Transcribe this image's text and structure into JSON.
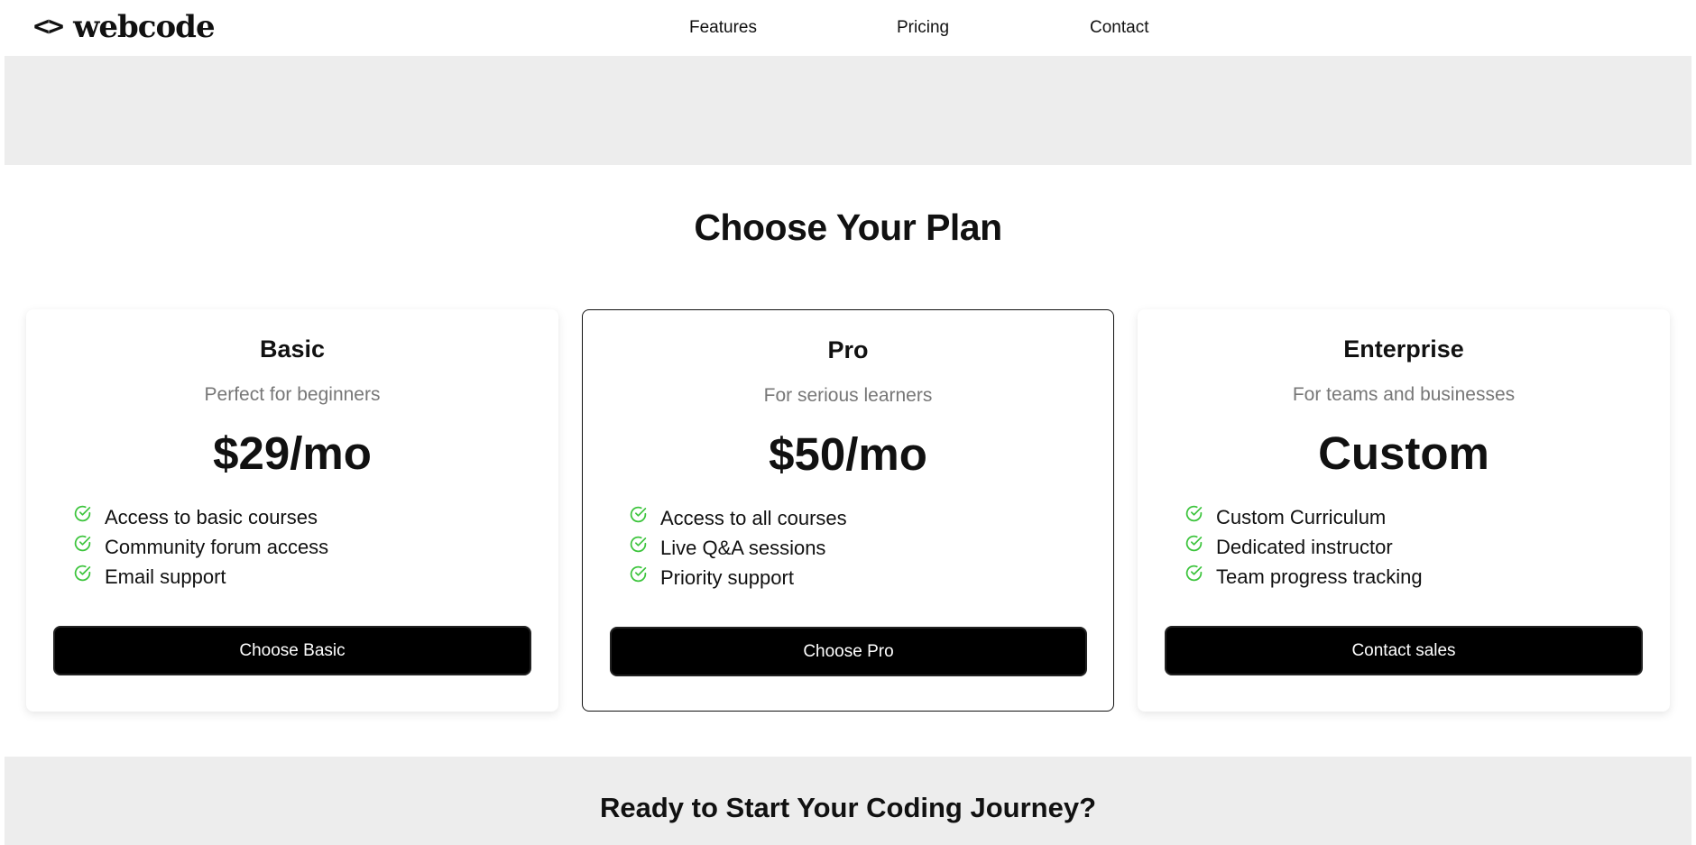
{
  "header": {
    "logo_icon": "<>",
    "logo_text": "webcode",
    "nav": [
      "Features",
      "Pricing",
      "Contact"
    ]
  },
  "pricing": {
    "title": "Choose Your Plan",
    "plans": [
      {
        "name": "Basic",
        "tagline": "Perfect for beginners",
        "price": "$29/mo",
        "features": [
          "Access to basic courses",
          "Community forum access",
          "Email support"
        ],
        "button": "Choose Basic"
      },
      {
        "name": "Pro",
        "tagline": "For serious learners",
        "price": "$50/mo",
        "features": [
          "Access to all courses",
          "Live Q&A sessions",
          "Priority support"
        ],
        "button": "Choose Pro"
      },
      {
        "name": "Enterprise",
        "tagline": "For teams and businesses",
        "price": "Custom",
        "features": [
          "Custom Curriculum",
          "Dedicated instructor",
          "Team progress tracking"
        ],
        "button": "Contact sales"
      }
    ]
  },
  "cta": {
    "title": "Ready to Start Your Coding Journey?"
  },
  "colors": {
    "check": "#3cc43c",
    "band": "#ededed",
    "button": "#000000"
  },
  "icons": {
    "logo": "code-brackets-icon",
    "feature": "check-circle-icon"
  }
}
